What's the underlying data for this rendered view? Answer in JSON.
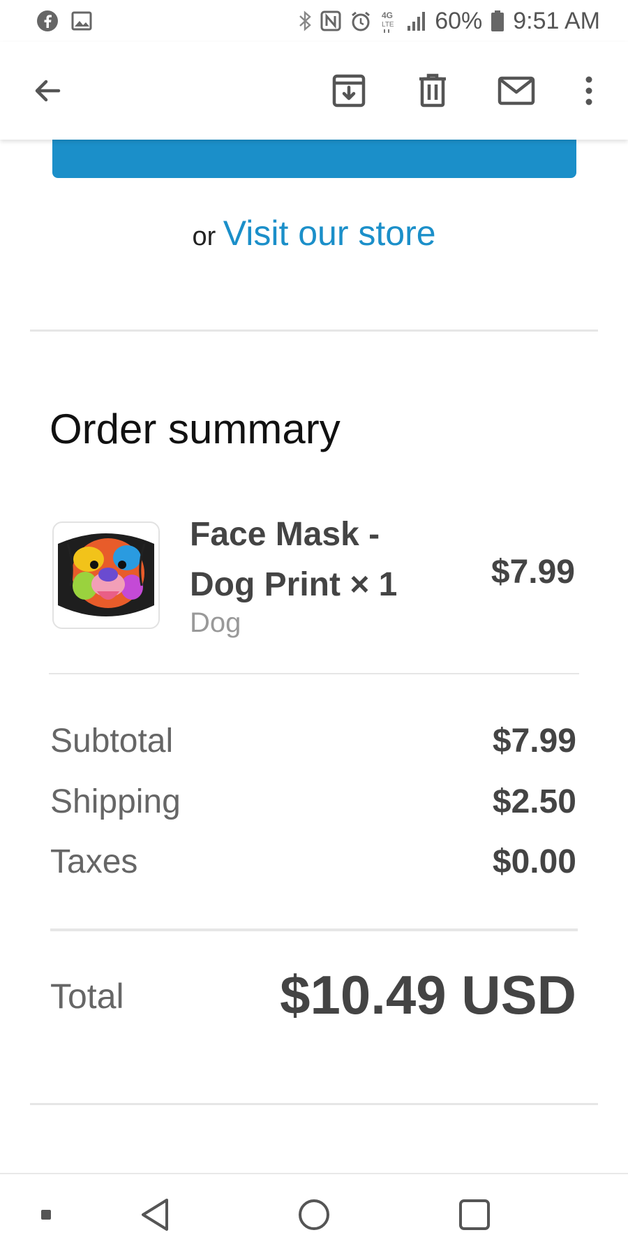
{
  "status_bar": {
    "left_icons": [
      "facebook-icon",
      "image-icon"
    ],
    "right_icons": [
      "bluetooth-icon",
      "nfc-icon",
      "alarm-icon",
      "lte-4g-icon",
      "signal-icon",
      "battery-icon"
    ],
    "battery": "60%",
    "time": "9:51 AM"
  },
  "toolbar": {
    "icons": [
      "back-arrow-icon",
      "archive-icon",
      "delete-icon",
      "mark-unread-icon",
      "more-vert-icon"
    ]
  },
  "visit": {
    "prefix": "or",
    "link": "Visit our store"
  },
  "order_summary": {
    "title": "Order summary",
    "item": {
      "name": "Face Mask - Dog Print × 1",
      "variant": "Dog",
      "price": "$7.99"
    },
    "rows": [
      {
        "label": "Subtotal",
        "value": "$7.99"
      },
      {
        "label": "Shipping",
        "value": "$2.50"
      },
      {
        "label": "Taxes",
        "value": "$0.00"
      }
    ],
    "total": {
      "label": "Total",
      "value": "$10.49 USD"
    }
  },
  "colors": {
    "accent": "#1b8fc9",
    "text_dark": "#444444",
    "text_muted": "#999999"
  },
  "nav_bar": {
    "icons": [
      "menu-dot-icon",
      "nav-back-icon",
      "home-icon",
      "recents-icon"
    ]
  }
}
